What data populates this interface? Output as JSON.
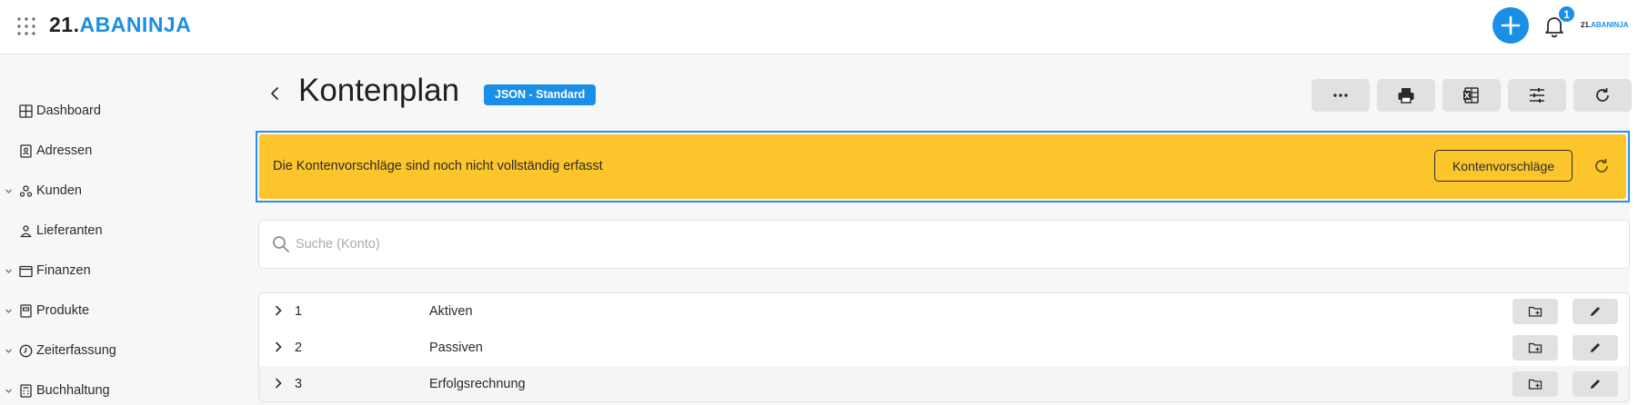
{
  "brand": {
    "number": "21.",
    "name": "ABANINJA"
  },
  "topbar": {
    "notification_count": "1",
    "user_logo": {
      "number": "21.",
      "name": "ABANINJA"
    },
    "accent_color": "#1a8fe8"
  },
  "sidebar": {
    "items": [
      {
        "label": "Dashboard",
        "icon": "dashboard-icon",
        "expandable": false
      },
      {
        "label": "Adressen",
        "icon": "address-book-icon",
        "expandable": false
      },
      {
        "label": "Kunden",
        "icon": "customers-icon",
        "expandable": true
      },
      {
        "label": "Lieferanten",
        "icon": "suppliers-icon",
        "expandable": false
      },
      {
        "label": "Finanzen",
        "icon": "wallet-icon",
        "expandable": true
      },
      {
        "label": "Produkte",
        "icon": "product-icon",
        "expandable": true
      },
      {
        "label": "Zeiterfassung",
        "icon": "clock-icon",
        "expandable": true
      },
      {
        "label": "Buchhaltung",
        "icon": "calculator-icon",
        "expandable": true
      }
    ]
  },
  "page": {
    "title": "Kontenplan",
    "tag": "JSON - Standard"
  },
  "toolbar": {
    "buttons": [
      "more-icon",
      "print-icon",
      "excel-icon",
      "filter-settings-icon",
      "refresh-icon"
    ]
  },
  "banner": {
    "message": "Die Kontenvorschläge sind noch nicht vollständig erfasst",
    "button_label": "Kontenvorschläge",
    "color": "#fcc52c"
  },
  "search": {
    "placeholder": "Suche (Konto)",
    "value": ""
  },
  "accounts": {
    "rows": [
      {
        "number": "1",
        "name": "Aktiven"
      },
      {
        "number": "2",
        "name": "Passiven"
      },
      {
        "number": "3",
        "name": "Erfolgsrechnung"
      }
    ]
  }
}
